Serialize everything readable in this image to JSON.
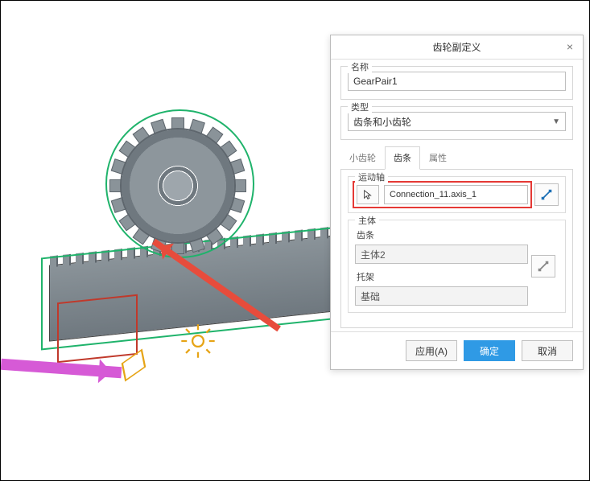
{
  "dialog": {
    "title": "齿轮副定义",
    "name_section": {
      "label": "名称",
      "value": "GearPair1"
    },
    "type_section": {
      "label": "类型",
      "value": "齿条和小齿轮"
    },
    "tabs": {
      "pinion": "小齿轮",
      "rack": "齿条",
      "attrs": "属性"
    },
    "motion_axis": {
      "label": "运动轴",
      "value": "Connection_11.axis_1"
    },
    "body": {
      "label": "主体",
      "rack_label": "齿条",
      "rack_value": "主体2",
      "carrier_label": "托架",
      "carrier_value": "基础"
    },
    "buttons": {
      "apply": "应用(A)",
      "ok": "确定",
      "cancel": "取消"
    }
  }
}
